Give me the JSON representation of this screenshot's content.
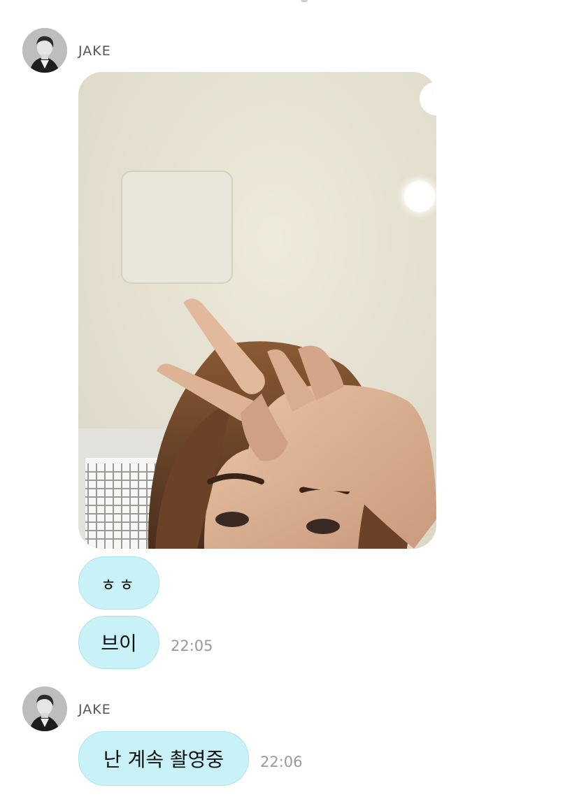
{
  "chat": {
    "messages": [
      {
        "sender": "JAKE",
        "avatar_icon": "profile-photo-icon",
        "photo": {
          "type": "image",
          "description_icon": "selfie-peace-sign-photo"
        },
        "texts": [
          {
            "text": "ㅎㅎ",
            "time": ""
          },
          {
            "text": "브이",
            "time": "22:05"
          }
        ]
      },
      {
        "sender": "JAKE",
        "avatar_icon": "profile-photo-icon",
        "texts": [
          {
            "text": "난 계속 촬영중",
            "time": "22:06"
          }
        ]
      }
    ]
  },
  "colors": {
    "bubble": "#c8f2f7",
    "bubble_border": "#a9e4ec",
    "timestamp": "#999999",
    "sender": "#555555"
  }
}
